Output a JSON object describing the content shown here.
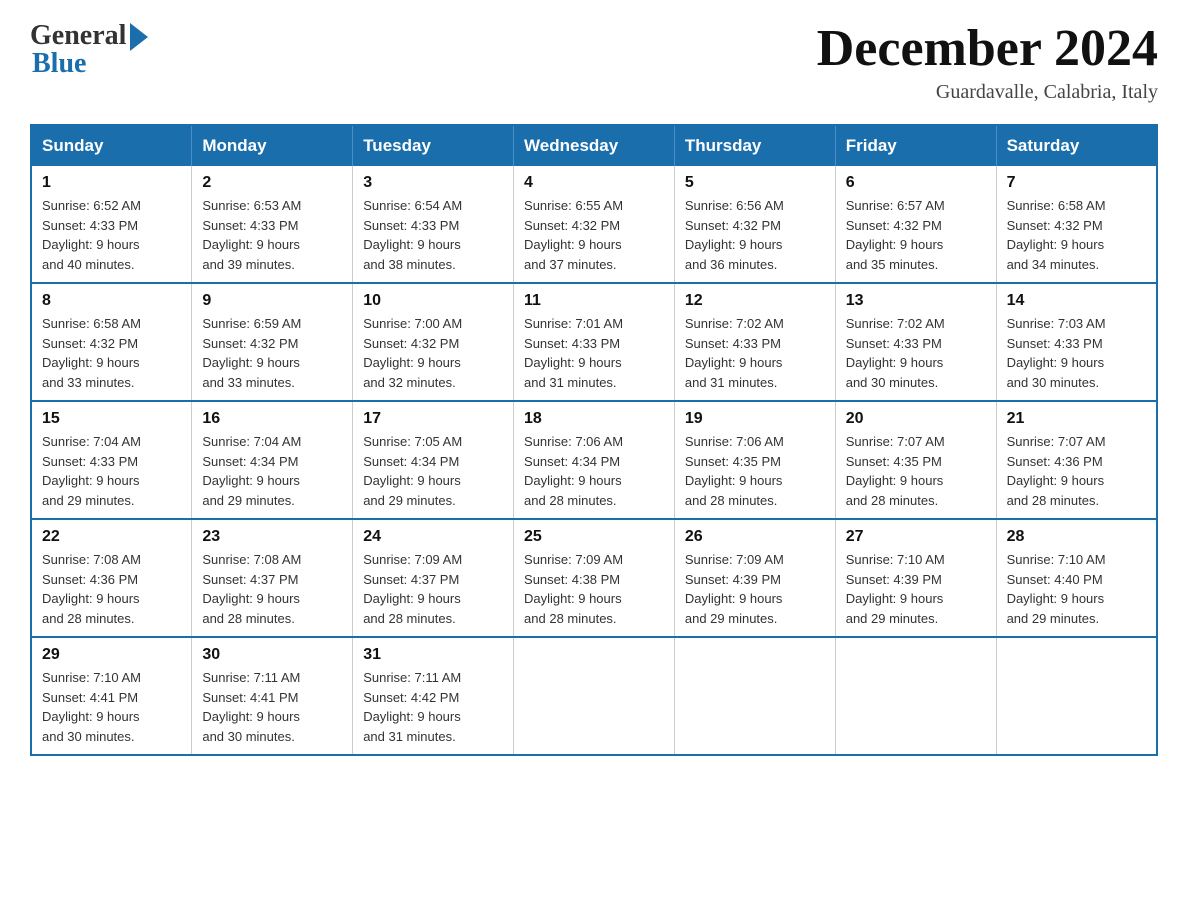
{
  "header": {
    "logo_general": "General",
    "logo_blue": "Blue",
    "month_title": "December 2024",
    "location": "Guardavalle, Calabria, Italy"
  },
  "days_of_week": [
    "Sunday",
    "Monday",
    "Tuesday",
    "Wednesday",
    "Thursday",
    "Friday",
    "Saturday"
  ],
  "weeks": [
    [
      {
        "day": "1",
        "sunrise": "6:52 AM",
        "sunset": "4:33 PM",
        "daylight": "9 hours and 40 minutes."
      },
      {
        "day": "2",
        "sunrise": "6:53 AM",
        "sunset": "4:33 PM",
        "daylight": "9 hours and 39 minutes."
      },
      {
        "day": "3",
        "sunrise": "6:54 AM",
        "sunset": "4:33 PM",
        "daylight": "9 hours and 38 minutes."
      },
      {
        "day": "4",
        "sunrise": "6:55 AM",
        "sunset": "4:32 PM",
        "daylight": "9 hours and 37 minutes."
      },
      {
        "day": "5",
        "sunrise": "6:56 AM",
        "sunset": "4:32 PM",
        "daylight": "9 hours and 36 minutes."
      },
      {
        "day": "6",
        "sunrise": "6:57 AM",
        "sunset": "4:32 PM",
        "daylight": "9 hours and 35 minutes."
      },
      {
        "day": "7",
        "sunrise": "6:58 AM",
        "sunset": "4:32 PM",
        "daylight": "9 hours and 34 minutes."
      }
    ],
    [
      {
        "day": "8",
        "sunrise": "6:58 AM",
        "sunset": "4:32 PM",
        "daylight": "9 hours and 33 minutes."
      },
      {
        "day": "9",
        "sunrise": "6:59 AM",
        "sunset": "4:32 PM",
        "daylight": "9 hours and 33 minutes."
      },
      {
        "day": "10",
        "sunrise": "7:00 AM",
        "sunset": "4:32 PM",
        "daylight": "9 hours and 32 minutes."
      },
      {
        "day": "11",
        "sunrise": "7:01 AM",
        "sunset": "4:33 PM",
        "daylight": "9 hours and 31 minutes."
      },
      {
        "day": "12",
        "sunrise": "7:02 AM",
        "sunset": "4:33 PM",
        "daylight": "9 hours and 31 minutes."
      },
      {
        "day": "13",
        "sunrise": "7:02 AM",
        "sunset": "4:33 PM",
        "daylight": "9 hours and 30 minutes."
      },
      {
        "day": "14",
        "sunrise": "7:03 AM",
        "sunset": "4:33 PM",
        "daylight": "9 hours and 30 minutes."
      }
    ],
    [
      {
        "day": "15",
        "sunrise": "7:04 AM",
        "sunset": "4:33 PM",
        "daylight": "9 hours and 29 minutes."
      },
      {
        "day": "16",
        "sunrise": "7:04 AM",
        "sunset": "4:34 PM",
        "daylight": "9 hours and 29 minutes."
      },
      {
        "day": "17",
        "sunrise": "7:05 AM",
        "sunset": "4:34 PM",
        "daylight": "9 hours and 29 minutes."
      },
      {
        "day": "18",
        "sunrise": "7:06 AM",
        "sunset": "4:34 PM",
        "daylight": "9 hours and 28 minutes."
      },
      {
        "day": "19",
        "sunrise": "7:06 AM",
        "sunset": "4:35 PM",
        "daylight": "9 hours and 28 minutes."
      },
      {
        "day": "20",
        "sunrise": "7:07 AM",
        "sunset": "4:35 PM",
        "daylight": "9 hours and 28 minutes."
      },
      {
        "day": "21",
        "sunrise": "7:07 AM",
        "sunset": "4:36 PM",
        "daylight": "9 hours and 28 minutes."
      }
    ],
    [
      {
        "day": "22",
        "sunrise": "7:08 AM",
        "sunset": "4:36 PM",
        "daylight": "9 hours and 28 minutes."
      },
      {
        "day": "23",
        "sunrise": "7:08 AM",
        "sunset": "4:37 PM",
        "daylight": "9 hours and 28 minutes."
      },
      {
        "day": "24",
        "sunrise": "7:09 AM",
        "sunset": "4:37 PM",
        "daylight": "9 hours and 28 minutes."
      },
      {
        "day": "25",
        "sunrise": "7:09 AM",
        "sunset": "4:38 PM",
        "daylight": "9 hours and 28 minutes."
      },
      {
        "day": "26",
        "sunrise": "7:09 AM",
        "sunset": "4:39 PM",
        "daylight": "9 hours and 29 minutes."
      },
      {
        "day": "27",
        "sunrise": "7:10 AM",
        "sunset": "4:39 PM",
        "daylight": "9 hours and 29 minutes."
      },
      {
        "day": "28",
        "sunrise": "7:10 AM",
        "sunset": "4:40 PM",
        "daylight": "9 hours and 29 minutes."
      }
    ],
    [
      {
        "day": "29",
        "sunrise": "7:10 AM",
        "sunset": "4:41 PM",
        "daylight": "9 hours and 30 minutes."
      },
      {
        "day": "30",
        "sunrise": "7:11 AM",
        "sunset": "4:41 PM",
        "daylight": "9 hours and 30 minutes."
      },
      {
        "day": "31",
        "sunrise": "7:11 AM",
        "sunset": "4:42 PM",
        "daylight": "9 hours and 31 minutes."
      },
      null,
      null,
      null,
      null
    ]
  ],
  "labels": {
    "sunrise": "Sunrise:",
    "sunset": "Sunset:",
    "daylight": "Daylight:"
  }
}
